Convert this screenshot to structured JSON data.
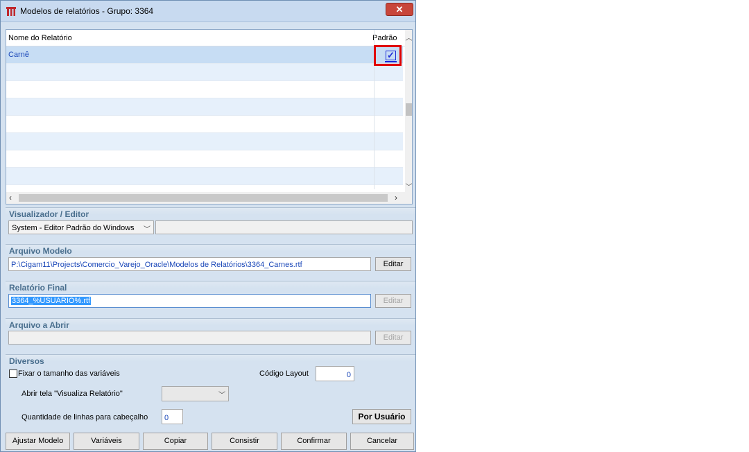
{
  "window": {
    "title": "Modelos de relatórios - Grupo: 3364",
    "close_glyph": "✕"
  },
  "grid": {
    "columns": [
      "Nome do Relatório",
      "Padrão"
    ],
    "rows": [
      {
        "name": "Carnê",
        "padrao_checked": true
      }
    ],
    "check_glyph": "✓"
  },
  "visualizador": {
    "title": "Visualizador / Editor",
    "selected": "System - Editor Padrão do Windows",
    "extra_value": ""
  },
  "arquivo_modelo": {
    "title": "Arquivo Modelo",
    "value": "P:\\Cigam11\\Projects\\Comercio_Varejo_Oracle\\Modelos de Relatórios\\3364_Carnes.rtf",
    "button": "Editar"
  },
  "relatorio_final": {
    "title": "Relatório Final",
    "value": "3364_%USUARIO%.rtf",
    "button": "Editar"
  },
  "arquivo_abrir": {
    "title": "Arquivo a Abrir",
    "value": "",
    "button": "Editar"
  },
  "diversos": {
    "title": "Diversos",
    "fixar_label": "Fixar o tamanho das variáveis",
    "codigo_layout_label": "Código Layout",
    "codigo_layout_value": "0",
    "abrir_tela_label": "Abrir tela \"Visualiza Relatório\"",
    "abrir_tela_selected": "",
    "qtd_linhas_label": "Quantidade de linhas para cabeçalho",
    "qtd_linhas_value": "0",
    "por_usuario_button": "Por Usuário"
  },
  "footer": {
    "buttons": [
      "Ajustar Modelo",
      "Variáveis",
      "Copiar",
      "Consistir",
      "Confirmar",
      "Cancelar"
    ]
  },
  "colors": {
    "window_bg": "#d5e2f0",
    "section_title": "#4a6f8e",
    "highlight_box": "#e00000",
    "close_button": "#c8463b",
    "selection": "#3399ff"
  }
}
